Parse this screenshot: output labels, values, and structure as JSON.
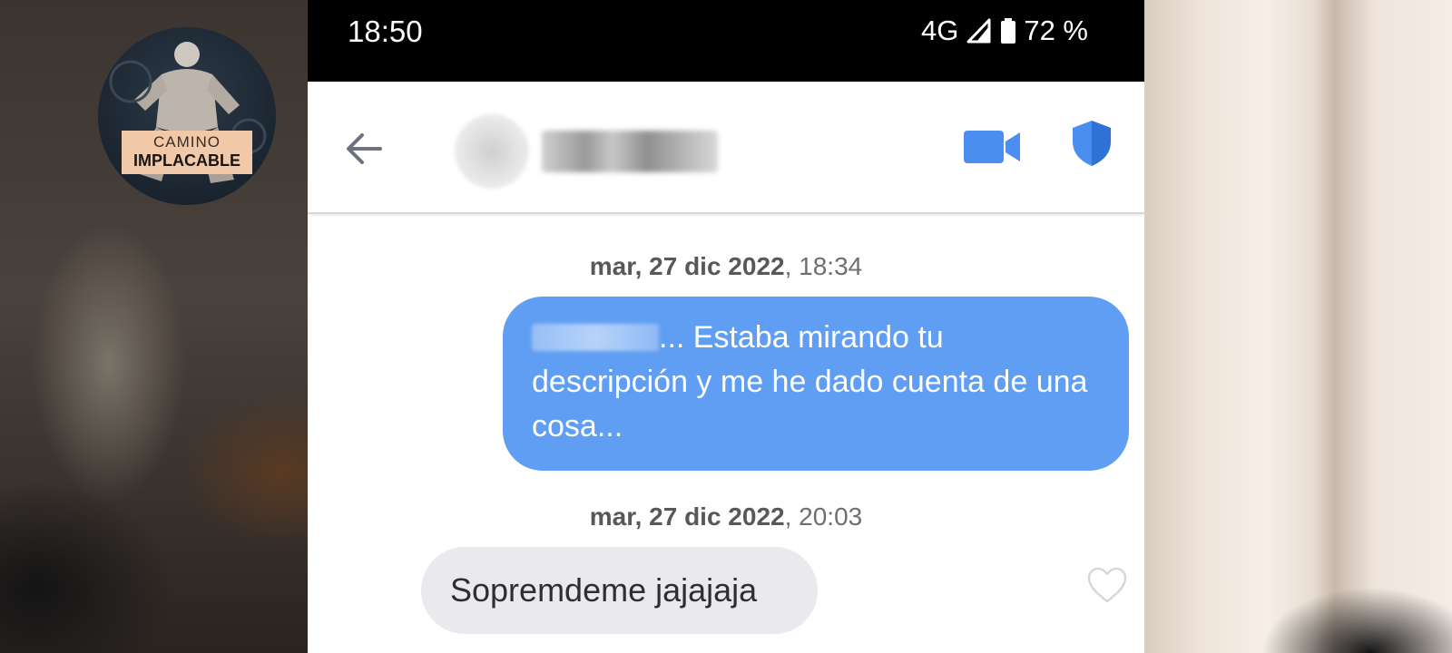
{
  "overlay": {
    "logo_line1": "CAMINO",
    "logo_line2": "IMPLACABLE"
  },
  "status_bar": {
    "time": "18:50",
    "network": "4G",
    "battery": "72 %"
  },
  "chat_header": {
    "contact_name": "",
    "icons": [
      "back-arrow-icon",
      "video-call-icon",
      "shield-icon"
    ]
  },
  "messages": [
    {
      "timestamp_date": "mar, 27 dic 2022",
      "timestamp_time": ", 18:34",
      "direction": "outgoing",
      "text_after_redaction": "... Estaba mirando tu descripción y me he dado cuenta de una cosa..."
    },
    {
      "timestamp_date": "mar, 27 dic 2022",
      "timestamp_time": ", 20:03",
      "direction": "incoming",
      "text": "Sopremdeme jajajaja"
    }
  ],
  "colors": {
    "outgoing_bubble": "#5f9ef2",
    "incoming_bubble": "#e9e9ee",
    "accent_blue": "#4a8ef0"
  }
}
